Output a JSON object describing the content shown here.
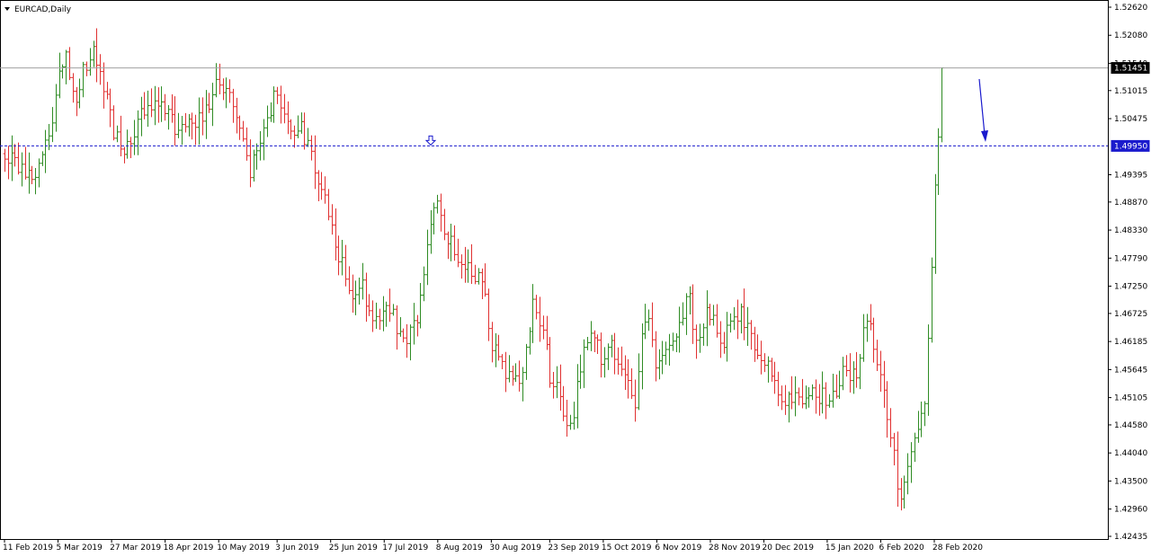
{
  "chart_data": {
    "type": "bar",
    "subtype": "ohlc",
    "title": "EURCAD,Daily",
    "y_ticks": [
      1.5262,
      1.5208,
      1.5154,
      1.51015,
      1.50475,
      1.49395,
      1.4887,
      1.4833,
      1.4779,
      1.4725,
      1.46725,
      1.46185,
      1.45645,
      1.45105,
      1.4458,
      1.4404,
      1.435,
      1.4296,
      1.42435
    ],
    "ylim": [
      1.42435,
      1.5262
    ],
    "x_tick_labels": [
      "11 Feb 2019",
      "5 Mar 2019",
      "27 Mar 2019",
      "18 Apr 2019",
      "10 May 2019",
      "3 Jun 2019",
      "25 Jun 2019",
      "17 Jul 2019",
      "8 Aug 2019",
      "30 Aug 2019",
      "23 Sep 2019",
      "15 Oct 2019",
      "6 Nov 2019",
      "28 Nov 2019",
      "20 Dec 2019",
      "15 Jan 2020",
      "6 Feb 2020",
      "28 Feb 2020"
    ],
    "current_price": 1.51451,
    "horizontal_line": 1.4995,
    "grid": false,
    "bar_colors": {
      "up": "#2e8b23",
      "down": "#e03030"
    },
    "level_colors": {
      "current_price": "#a0a0a0",
      "horizontal_line": "#1a1acd"
    },
    "anchors": [
      [
        "11 Feb 2019",
        1.498
      ],
      [
        "14 Feb 2019",
        1.497
      ],
      [
        "20 Feb 2019",
        1.494
      ],
      [
        "25 Feb 2019",
        1.496
      ],
      [
        "28 Feb 2019",
        1.499
      ],
      [
        "5 Mar 2019",
        1.512
      ],
      [
        "8 Mar 2019",
        1.516
      ],
      [
        "12 Mar 2019",
        1.509
      ],
      [
        "15 Mar 2019",
        1.513
      ],
      [
        "20 Mar 2019",
        1.518
      ],
      [
        "22 Mar 2019",
        1.515
      ],
      [
        "27 Mar 2019",
        1.504
      ],
      [
        "1 Apr 2019",
        1.497
      ],
      [
        "5 Apr 2019",
        1.503
      ],
      [
        "10 Apr 2019",
        1.507
      ],
      [
        "15 Apr 2019",
        1.509
      ],
      [
        "18 Apr 2019",
        1.507
      ],
      [
        "24 Apr 2019",
        1.502
      ],
      [
        "30 Apr 2019",
        1.504
      ],
      [
        "6 May 2019",
        1.508
      ],
      [
        "10 May 2019",
        1.512
      ],
      [
        "15 May 2019",
        1.508
      ],
      [
        "20 May 2019",
        1.5
      ],
      [
        "23 May 2019",
        1.494
      ],
      [
        "28 May 2019",
        1.503
      ],
      [
        "3 Jun 2019",
        1.51
      ],
      [
        "7 Jun 2019",
        1.504
      ],
      [
        "12 Jun 2019",
        1.503
      ],
      [
        "17 Jun 2019",
        1.5
      ],
      [
        "20 Jun 2019",
        1.492
      ],
      [
        "25 Jun 2019",
        1.486
      ],
      [
        "28 Jun 2019",
        1.478
      ],
      [
        "3 Jul 2019",
        1.47
      ],
      [
        "8 Jul 2019",
        1.473
      ],
      [
        "11 Jul 2019",
        1.466
      ],
      [
        "17 Jul 2019",
        1.469
      ],
      [
        "22 Jul 2019",
        1.465
      ],
      [
        "26 Jul 2019",
        1.462
      ],
      [
        "31 Jul 2019",
        1.468
      ],
      [
        "5 Aug 2019",
        1.484
      ],
      [
        "8 Aug 2019",
        1.488
      ],
      [
        "13 Aug 2019",
        1.481
      ],
      [
        "16 Aug 2019",
        1.479
      ],
      [
        "21 Aug 2019",
        1.476
      ],
      [
        "26 Aug 2019",
        1.474
      ],
      [
        "30 Aug 2019",
        1.462
      ],
      [
        "5 Sep 2019",
        1.456
      ],
      [
        "11 Sep 2019",
        1.452
      ],
      [
        "16 Sep 2019",
        1.468
      ],
      [
        "20 Sep 2019",
        1.466
      ],
      [
        "23 Sep 2019",
        1.455
      ],
      [
        "27 Sep 2019",
        1.45
      ],
      [
        "2 Oct 2019",
        1.446
      ],
      [
        "7 Oct 2019",
        1.462
      ],
      [
        "11 Oct 2019",
        1.463
      ],
      [
        "15 Oct 2019",
        1.458
      ],
      [
        "18 Oct 2019",
        1.461
      ],
      [
        "23 Oct 2019",
        1.456
      ],
      [
        "28 Oct 2019",
        1.449
      ],
      [
        "1 Nov 2019",
        1.468
      ],
      [
        "6 Nov 2019",
        1.457
      ],
      [
        "11 Nov 2019",
        1.46
      ],
      [
        "14 Nov 2019",
        1.463
      ],
      [
        "19 Nov 2019",
        1.471
      ],
      [
        "22 Nov 2019",
        1.462
      ],
      [
        "28 Nov 2019",
        1.468
      ],
      [
        "3 Dec 2019",
        1.462
      ],
      [
        "6 Dec 2019",
        1.465
      ],
      [
        "11 Dec 2019",
        1.467
      ],
      [
        "16 Dec 2019",
        1.46
      ],
      [
        "20 Dec 2019",
        1.457
      ],
      [
        "27 Dec 2019",
        1.451
      ],
      [
        "3 Jan 2020",
        1.45
      ],
      [
        "9 Jan 2020",
        1.453
      ],
      [
        "15 Jan 2020",
        1.45
      ],
      [
        "21 Jan 2020",
        1.455
      ],
      [
        "27 Jan 2020",
        1.456
      ],
      [
        "31 Jan 2020",
        1.466
      ],
      [
        "6 Feb 2020",
        1.456
      ],
      [
        "11 Feb 2020",
        1.44
      ],
      [
        "14 Feb 2020",
        1.432
      ],
      [
        "19 Feb 2020",
        1.44
      ],
      [
        "24 Feb 2020",
        1.45
      ],
      [
        "26 Feb 2020",
        1.47
      ],
      [
        "28 Feb 2020",
        1.49
      ],
      [
        "2 Mar 2020",
        1.508
      ],
      [
        "3 Mar 2020",
        1.5145
      ]
    ]
  }
}
